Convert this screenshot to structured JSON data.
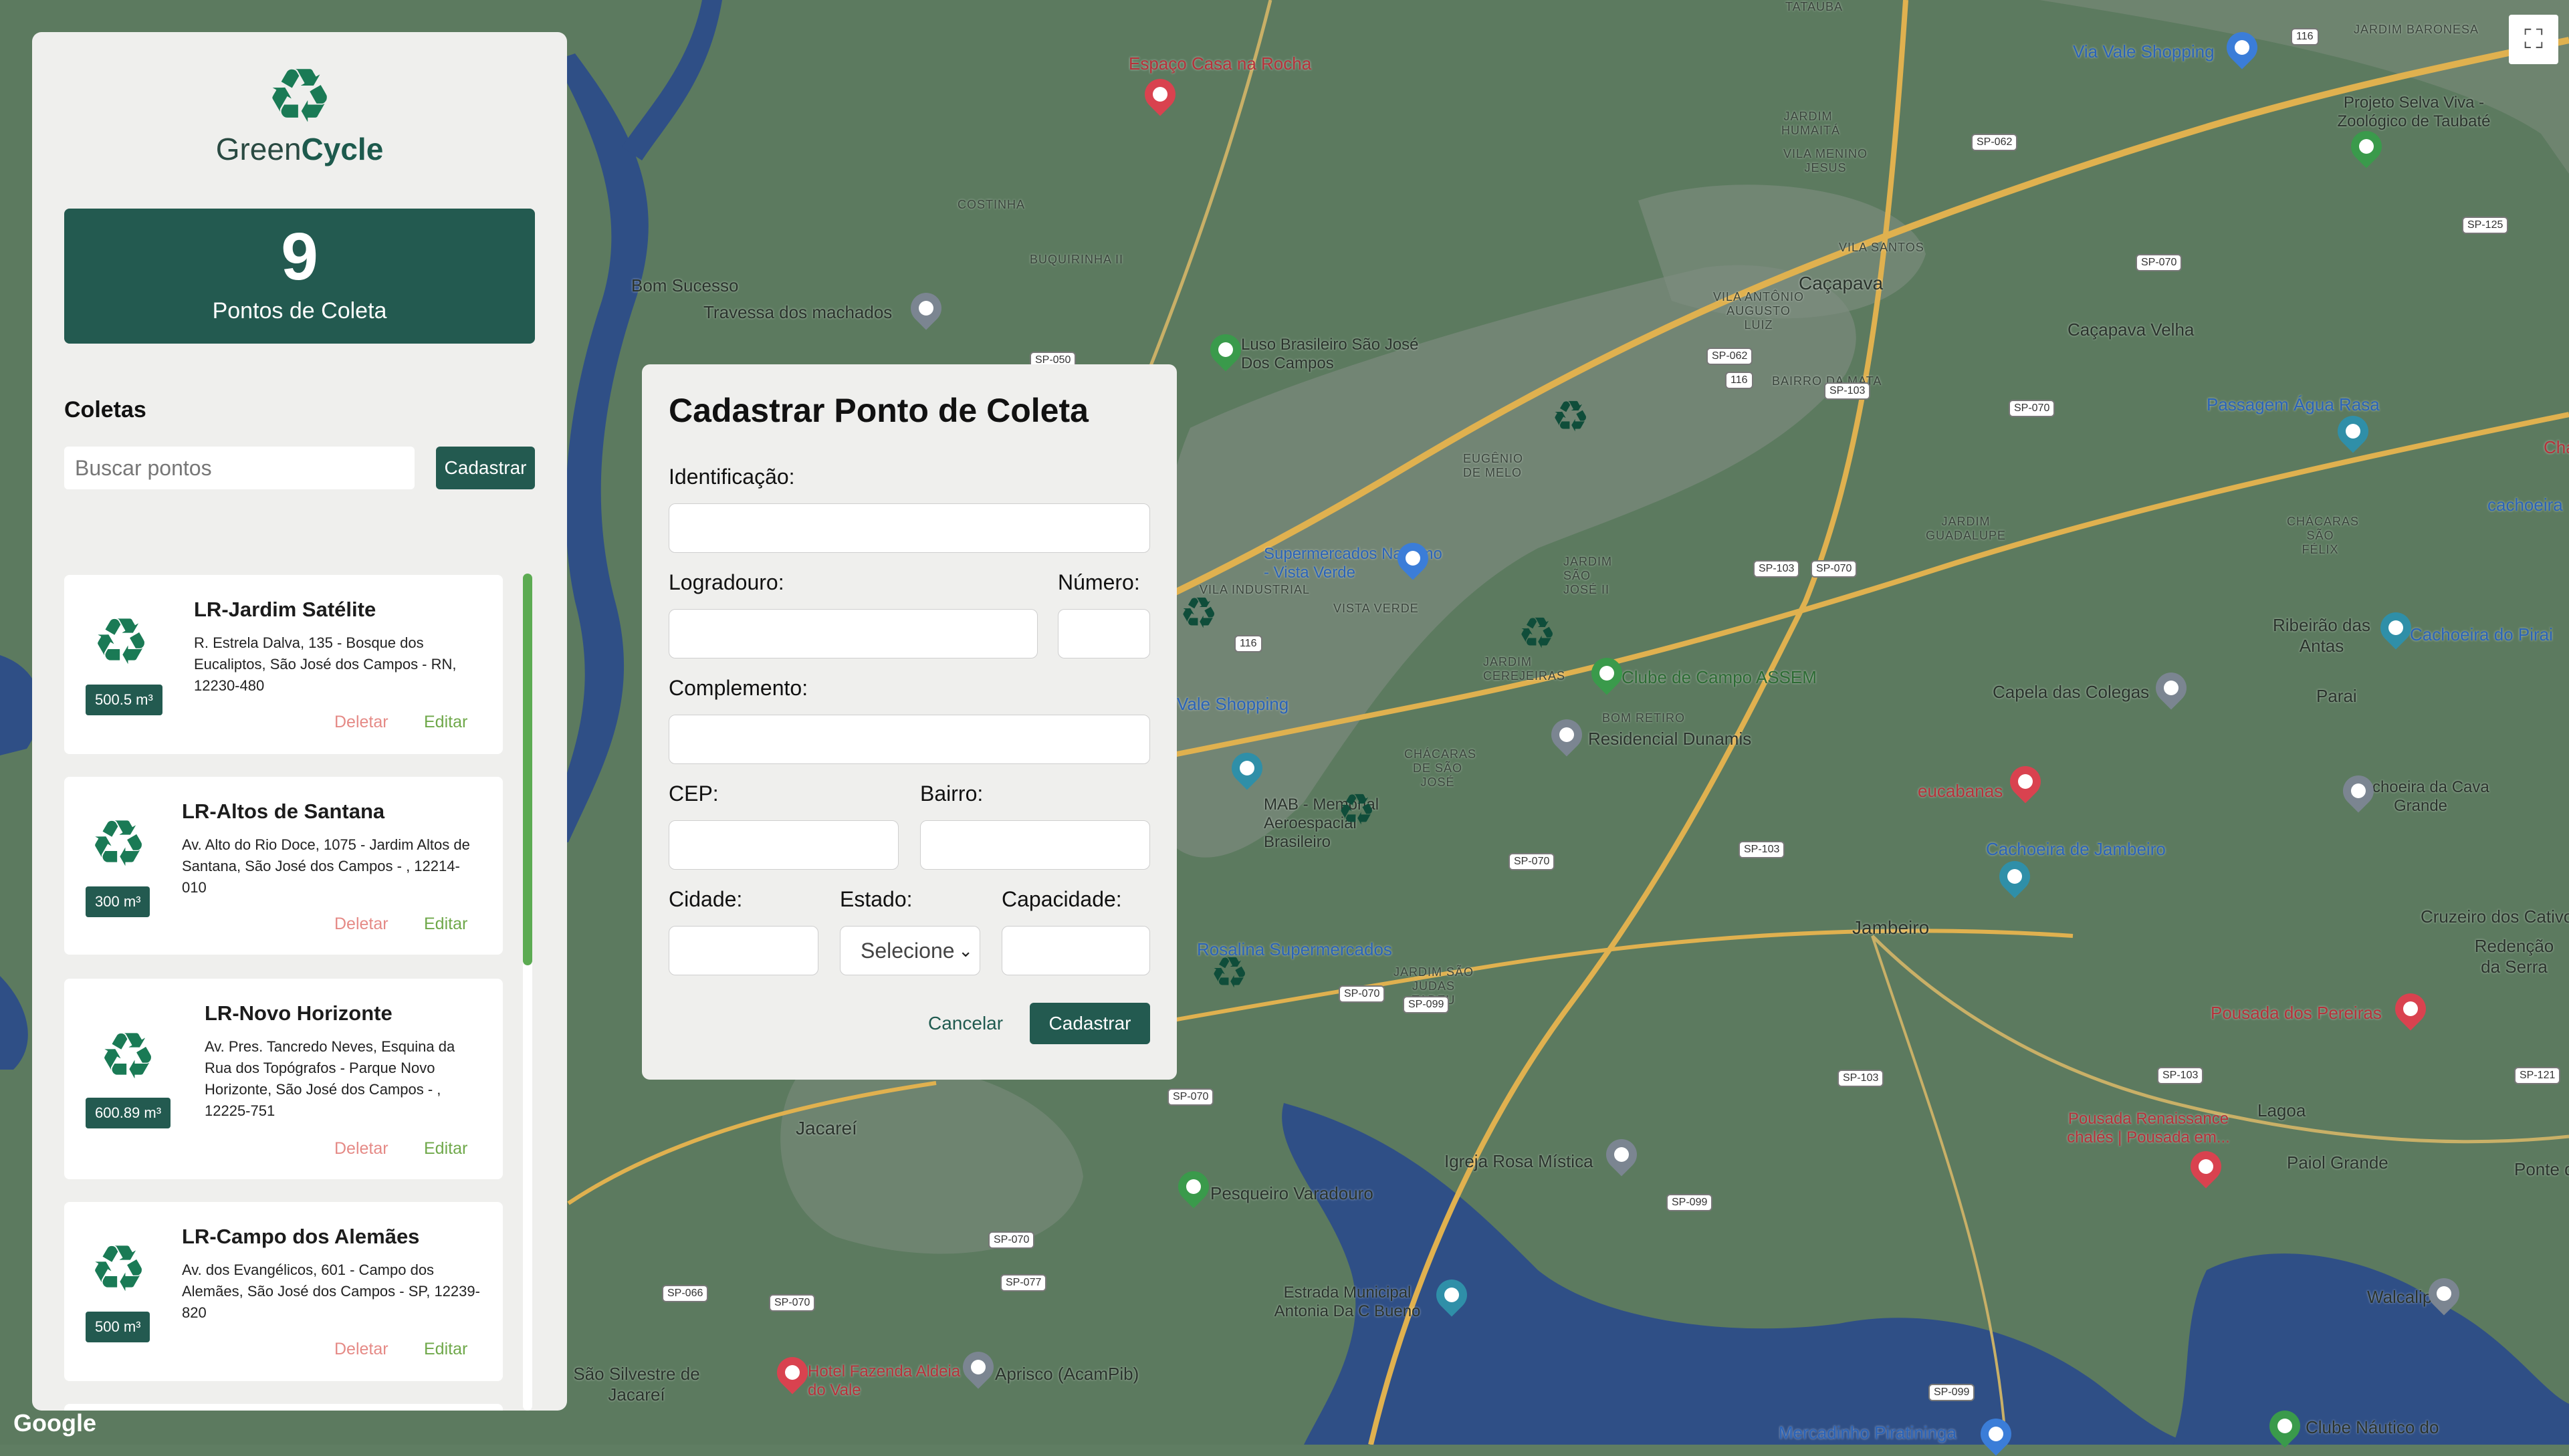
{
  "brand": {
    "name_regular": "Green",
    "name_bold": "Cycle",
    "logo_icon": "recycle-icon"
  },
  "stats": {
    "count": "9",
    "label": "Pontos de Coleta"
  },
  "list_section": {
    "title": "Coletas",
    "search_placeholder": "Buscar pontos",
    "register_button": "Cadastrar"
  },
  "collection_points": [
    {
      "name": "LR-Jardim Satélite",
      "address": "R. Estrela Dalva, 135 - Bosque dos Eucaliptos, São José dos Campos - RN, 12230-480",
      "capacity": "500.5 m³",
      "delete": "Deletar",
      "edit": "Editar"
    },
    {
      "name": "LR-Altos de Santana",
      "address": "Av. Alto do Rio Doce, 1075 - Jardim Altos de Santana, São José dos Campos - , 12214-010",
      "capacity": "300 m³",
      "delete": "Deletar",
      "edit": "Editar"
    },
    {
      "name": "LR-Novo Horizonte",
      "address": "Av. Pres. Tancredo Neves, Esquina da Rua dos Topógrafos - Parque Novo Horizonte, São José dos Campos - , 12225-751",
      "capacity": "600.89 m³",
      "delete": "Deletar",
      "edit": "Editar"
    },
    {
      "name": "LR-Campo dos Alemães",
      "address": "Av. dos Evangélicos, 601 - Campo dos Alemães, São José dos Campos - SP, 12239-820",
      "capacity": "500 m³",
      "delete": "Deletar",
      "edit": "Editar"
    }
  ],
  "modal": {
    "title": "Cadastrar Ponto de Coleta",
    "fields": {
      "identificacao": "Identificação:",
      "logradouro": "Logradouro:",
      "numero": "Número:",
      "complemento": "Complemento:",
      "cep": "CEP:",
      "bairro": "Bairro:",
      "cidade": "Cidade:",
      "estado": "Estado:",
      "capacidade": "Capacidade:"
    },
    "estado_selected": "Selecione",
    "cancel": "Cancelar",
    "submit": "Cadastrar"
  },
  "map": {
    "places": [
      "Espaço Casa na Rocha",
      "Via Vale Shopping",
      "JARDIM BARONESA",
      "Projeto Selva Viva - Zoológico de Taubaté",
      "Bom Sucesso",
      "Travessa dos machados",
      "Luso Brasileiro São José Dos Campos",
      "Caçapava",
      "Caçapava Velha",
      "Passagem Água Rasa",
      "Supermercados Nagumo - Vista Verde",
      "Clube de Campo ASSEM",
      "Residencial Dunamis",
      "Vale Shopping",
      "MAB - Memorial Aeroespacial Brasileiro",
      "eucabanas",
      "Capela das Colegas",
      "Ribeirão das Antas",
      "Cachoeira do Pirai",
      "Parai",
      "Cachoeira da Cava Grande",
      "Cachoeira de Jambeiro",
      "Jambeiro",
      "Rosalina Supermercados",
      "Cruzeiro dos Cativos",
      "Redenção da Serra",
      "Pousada dos Pereiras",
      "Jacareí",
      "Igreja Rosa Mística",
      "Pousada Renaissance chalés | Pousada em...",
      "Lagoa",
      "Paiol Grande",
      "Pesqueiro Varadouro",
      "Estrada Municipal Antonia Da C Bueno",
      "Walcalipos",
      "São Silvestre de Jacareí",
      "Hotel Fazenda Aldeia do Vale",
      "Aprisco (AcamPib)",
      "Mercadinho Piratininga",
      "Clube Náutico do",
      "VILA SANTOS",
      "VISTA VERDE",
      "VILA INDUSTRIAL",
      "JARDIM CEREJEIRAS",
      "BOM RETIRO",
      "JARDIM SÃO JOSÉ II",
      "JARDIM GUADALUPE",
      "CHÁCARAS SÃO FÉLIX",
      "BAIRRO DA MATA",
      "COSTINHA",
      "BUQUIRINHA II",
      "TATAUBA",
      "JARDIM HUMAITÁ",
      "VILA MENINO JESUS",
      "VILA ANTÔNIO AUGUSTO LUIZ",
      "EUGÊNIO DE MELO",
      "CHÁCARAS DE SÃO JOSÉ",
      "JARDIM SÃO JUDAS TADEU",
      "Ponte de",
      "cachoeira",
      "Cha do"
    ],
    "markers": 6,
    "fullscreen_icon": "fullscreen-icon",
    "attribution": "Google"
  }
}
